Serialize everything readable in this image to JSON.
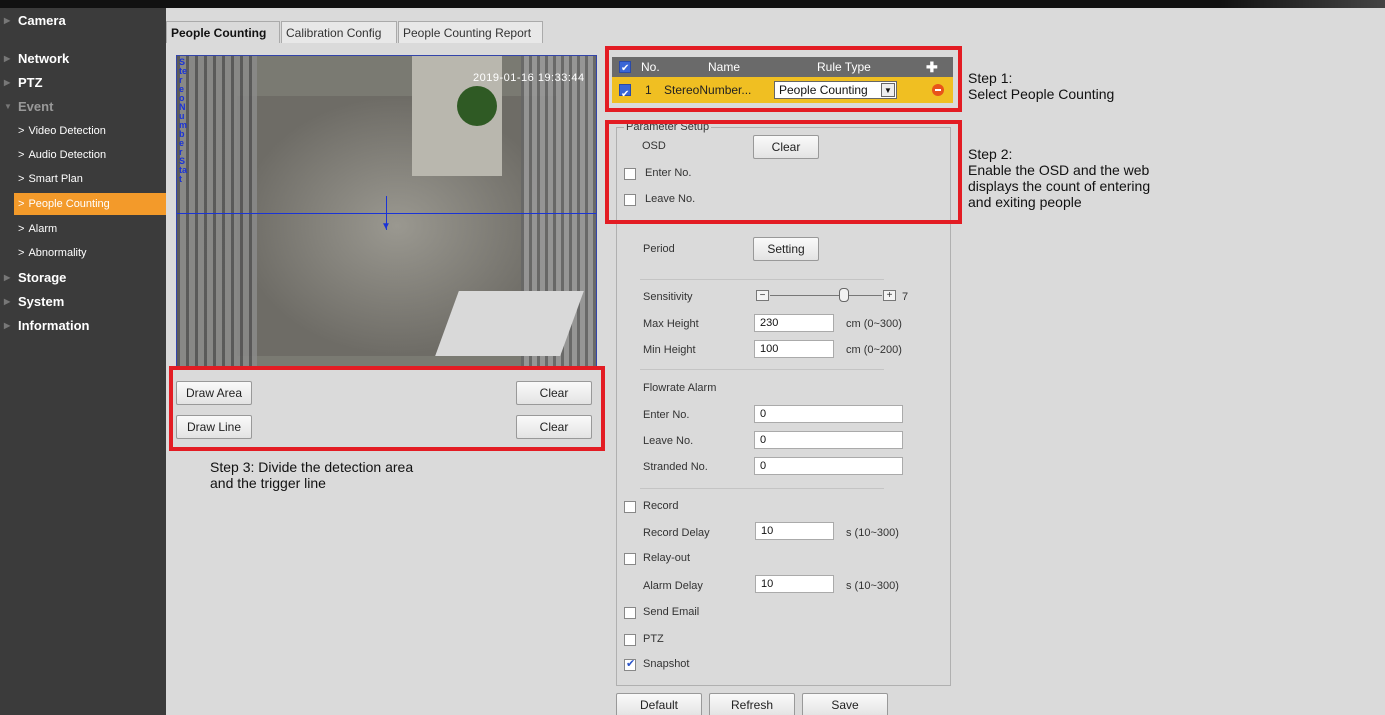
{
  "sidebar": {
    "items": [
      {
        "label": "Camera"
      },
      {
        "label": "Network"
      },
      {
        "label": "PTZ"
      },
      {
        "label": "Event"
      },
      {
        "label": "Video Detection"
      },
      {
        "label": "Audio Detection"
      },
      {
        "label": "Smart Plan"
      },
      {
        "label": "People Counting"
      },
      {
        "label": "Alarm"
      },
      {
        "label": "Abnormality"
      },
      {
        "label": "Storage"
      },
      {
        "label": "System"
      },
      {
        "label": "Information"
      }
    ]
  },
  "tabs": [
    {
      "label": "People Counting"
    },
    {
      "label": "Calibration Config"
    },
    {
      "label": "People Counting Report"
    }
  ],
  "video": {
    "timestamp": "2019-01-16 19:33:44",
    "vertical_label": "StereoNumberStat"
  },
  "area_buttons": {
    "draw_area": "Draw Area",
    "draw_line": "Draw Line",
    "clear": "Clear"
  },
  "rule_table": {
    "headers": {
      "no": "No.",
      "name": "Name",
      "rule_type": "Rule Type"
    },
    "row": {
      "no": "1",
      "name": "StereoNumber...",
      "rule_type": "People Counting"
    }
  },
  "steps": {
    "step1": "Step 1:\nSelect People Counting",
    "step2": "Step 2:\nEnable the OSD and the web\ndisplays the count of entering\nand exiting people",
    "step3": "Step 3: Divide the detection area\nand the trigger line"
  },
  "params": {
    "legend": "Parameter Setup",
    "osd_label": "OSD",
    "osd_clear": "Clear",
    "enter_no": "Enter No.",
    "leave_no": "Leave No.",
    "period_label": "Period",
    "period_button": "Setting",
    "sensitivity_label": "Sensitivity",
    "sensitivity_value": "7",
    "max_height_label": "Max Height",
    "max_height_value": "230",
    "max_height_unit": "cm (0~300)",
    "min_height_label": "Min Height",
    "min_height_value": "100",
    "min_height_unit": "cm (0~200)",
    "flowrate_alarm": "Flowrate Alarm",
    "flow_enter_label": "Enter No.",
    "flow_enter_value": "0",
    "flow_leave_label": "Leave No.",
    "flow_leave_value": "0",
    "stranded_label": "Stranded No.",
    "stranded_value": "0",
    "record_label": "Record",
    "record_delay_label": "Record Delay",
    "record_delay_value": "10",
    "record_delay_unit": "s (10~300)",
    "relay_label": "Relay-out",
    "alarm_delay_label": "Alarm Delay",
    "alarm_delay_value": "10",
    "alarm_delay_unit": "s (10~300)",
    "send_email_label": "Send Email",
    "ptz_label": "PTZ",
    "snapshot_label": "Snapshot"
  },
  "footer": {
    "default": "Default",
    "refresh": "Refresh",
    "save": "Save"
  },
  "colors": {
    "active_nav": "#f39a2a",
    "highlight_row": "#f0bf22",
    "annotation_red": "#e31c23",
    "rule_line": "#1a33d6"
  }
}
